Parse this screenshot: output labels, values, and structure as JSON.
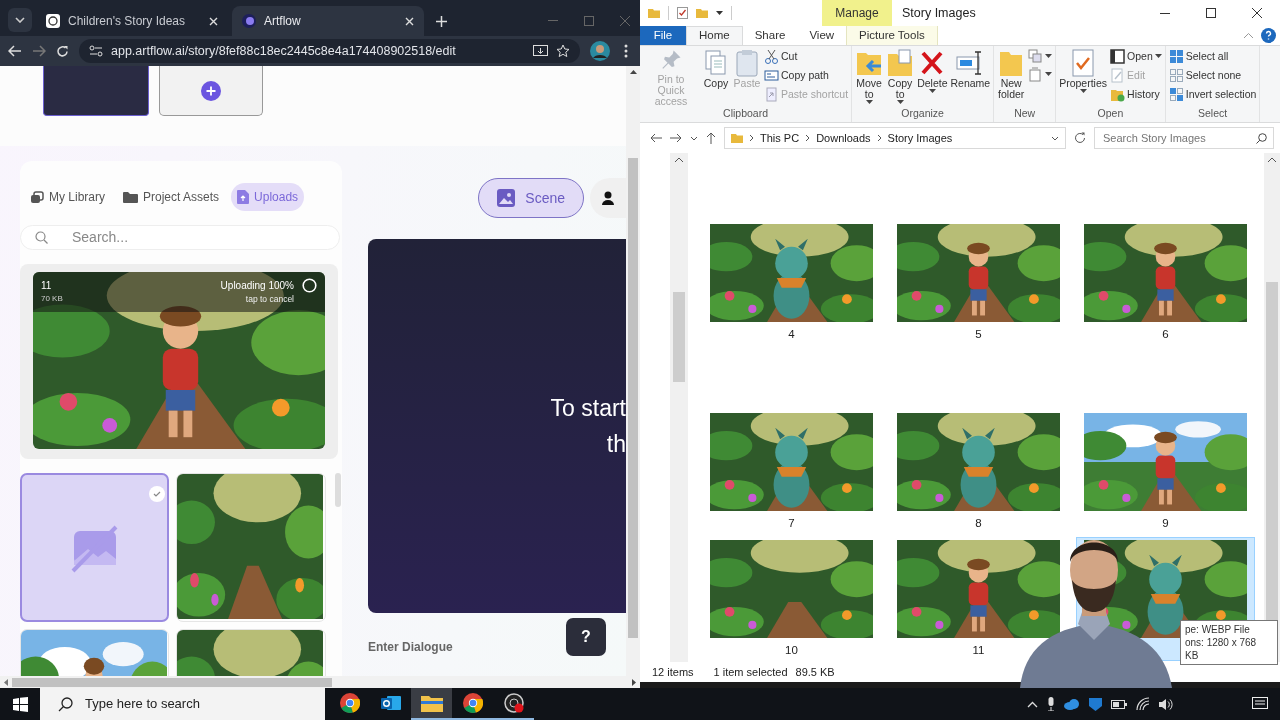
{
  "browser": {
    "tabs": [
      {
        "title": "Children's Story Ideas",
        "selected": false
      },
      {
        "title": "Artflow",
        "selected": true
      }
    ],
    "address": "app.artflow.ai/story/8fef88c18ec2445c8e4a174408902518/edit",
    "page": {
      "scene_cards": [
        {
          "kind": "scene"
        },
        {
          "kind": "add"
        }
      ],
      "library_tabs": [
        {
          "label": "My Library",
          "kind": "library",
          "selected": false
        },
        {
          "label": "Project Assets",
          "kind": "folder",
          "selected": false
        },
        {
          "label": "Uploads",
          "kind": "upload",
          "selected": true
        }
      ],
      "search": {
        "placeholder": "Search..."
      },
      "upload": {
        "name": "11",
        "size": "70 KB",
        "status": "Uploading 100%",
        "hint": "tap to cancel"
      },
      "assets": [
        {
          "kind": "missing",
          "selected": true
        },
        {
          "kind": "picture",
          "selected": false
        },
        {
          "kind": "picture",
          "selected": false
        },
        {
          "kind": "picture",
          "selected": false
        }
      ],
      "scene_button": "Scene",
      "canvas_text": [
        "To start",
        "th"
      ],
      "dialogue_label": "Enter Dialogue",
      "help_button": "?"
    }
  },
  "explorer": {
    "context_tab": "Manage",
    "title": "Story Images",
    "ribbon_tabs": [
      {
        "label": "File",
        "kind": "file",
        "selected": false
      },
      {
        "label": "Home",
        "kind": "tab",
        "selected": true
      },
      {
        "label": "Share",
        "kind": "tab",
        "selected": false
      },
      {
        "label": "View",
        "kind": "tab",
        "selected": false
      },
      {
        "label": "Picture Tools",
        "kind": "context",
        "selected": false
      }
    ],
    "groups": [
      {
        "name": "Clipboard",
        "items": [
          {
            "kind": "large",
            "label": "Pin to Quick access",
            "disabled": true,
            "menu": false
          },
          {
            "kind": "large",
            "label": "Copy",
            "disabled": false,
            "menu": false
          },
          {
            "kind": "large",
            "label": "Paste",
            "disabled": true,
            "menu": false
          },
          {
            "kind": "small",
            "label": "Cut",
            "disabled": false,
            "menu": false
          },
          {
            "kind": "small",
            "label": "Copy path",
            "disabled": false,
            "menu": false
          },
          {
            "kind": "small",
            "label": "Paste shortcut",
            "disabled": true,
            "menu": false
          }
        ]
      },
      {
        "name": "Organize",
        "items": [
          {
            "kind": "large",
            "label": "Move to",
            "disabled": false,
            "menu": true
          },
          {
            "kind": "large",
            "label": "Copy to",
            "disabled": false,
            "menu": true
          },
          {
            "kind": "large",
            "label": "Delete",
            "disabled": false,
            "menu": true
          },
          {
            "kind": "large",
            "label": "Rename",
            "disabled": false,
            "menu": false
          }
        ]
      },
      {
        "name": "New",
        "items": [
          {
            "kind": "large",
            "label": "New folder",
            "disabled": false,
            "menu": false
          },
          {
            "kind": "tiny",
            "disabled": false,
            "menu": true
          },
          {
            "kind": "tiny",
            "disabled": false,
            "menu": true
          }
        ]
      },
      {
        "name": "Open",
        "items": [
          {
            "kind": "large",
            "label": "Properties",
            "disabled": false,
            "menu": true
          },
          {
            "kind": "small",
            "label": "Open",
            "disabled": false,
            "menu": true
          },
          {
            "kind": "small",
            "label": "Edit",
            "disabled": true,
            "menu": false
          },
          {
            "kind": "small",
            "label": "History",
            "disabled": false,
            "menu": false
          }
        ]
      },
      {
        "name": "Select",
        "items": [
          {
            "kind": "small",
            "label": "Select all",
            "disabled": false,
            "menu": false
          },
          {
            "kind": "small",
            "label": "Select none",
            "disabled": false,
            "menu": false
          },
          {
            "kind": "small",
            "label": "Invert selection",
            "disabled": false,
            "menu": false
          }
        ]
      }
    ],
    "path": [
      "This PC",
      "Downloads",
      "Story Images"
    ],
    "search": {
      "placeholder": "Search Story Images"
    },
    "files": [
      {
        "label": "4",
        "selected": false
      },
      {
        "label": "5",
        "selected": false
      },
      {
        "label": "6",
        "selected": false
      },
      {
        "label": "7",
        "selected": false
      },
      {
        "label": "8",
        "selected": false
      },
      {
        "label": "9",
        "selected": false
      },
      {
        "label": "10",
        "selected": false
      },
      {
        "label": "11",
        "selected": false
      },
      {
        "selected": true
      }
    ],
    "tooltip": [
      "pe: WEBP File",
      "ons: 1280 x 768",
      "KB"
    ],
    "status": {
      "count": "12 items",
      "selection": "1 item selected",
      "size": "89.5 KB"
    }
  },
  "taskbar": {
    "search": {
      "placeholder": "Type here to search"
    },
    "apps": [
      {
        "kind": "chrome",
        "active": false,
        "running": false
      },
      {
        "kind": "outlook",
        "active": false,
        "running": false
      },
      {
        "kind": "folder",
        "active": true,
        "running": true
      },
      {
        "kind": "chrome",
        "active": false,
        "running": true
      },
      {
        "kind": "recorder",
        "active": false,
        "running": true
      }
    ]
  }
}
